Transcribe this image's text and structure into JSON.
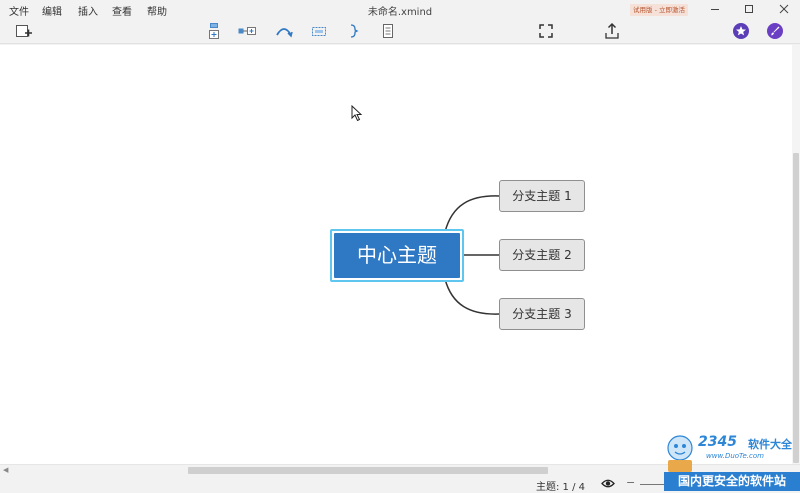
{
  "menu": [
    {
      "label": "文件"
    },
    {
      "label": "编辑"
    },
    {
      "label": "插入"
    },
    {
      "label": "查看"
    },
    {
      "label": "帮助"
    }
  ],
  "window": {
    "title": "未命名.xmind",
    "trial_badge": "试用版 - 立即激活"
  },
  "toolbar": {
    "icons": [
      "new-sheet-icon",
      "insert-topic-icon",
      "insert-subtopic-icon",
      "relationship-icon",
      "boundary-icon",
      "summary-icon",
      "notes-icon",
      "fullscreen-icon",
      "share-export-icon",
      "star-icon",
      "brush-icon"
    ]
  },
  "mindmap": {
    "central_topic": "中心主题",
    "subtopics": [
      "分支主题 1",
      "分支主题 2",
      "分支主题 3"
    ],
    "colors": {
      "central_fill": "#2f78c4",
      "central_selection": "#5fc7ef",
      "subtopic_fill": "#e6e6e6",
      "line": "#333333"
    }
  },
  "status": {
    "topic_count": "主题: 1 / 4"
  },
  "watermark": {
    "brand": "2345",
    "brand_suffix": "软件大全",
    "url": "www.DuoTe.com",
    "slogan": "国内更安全的软件站"
  }
}
